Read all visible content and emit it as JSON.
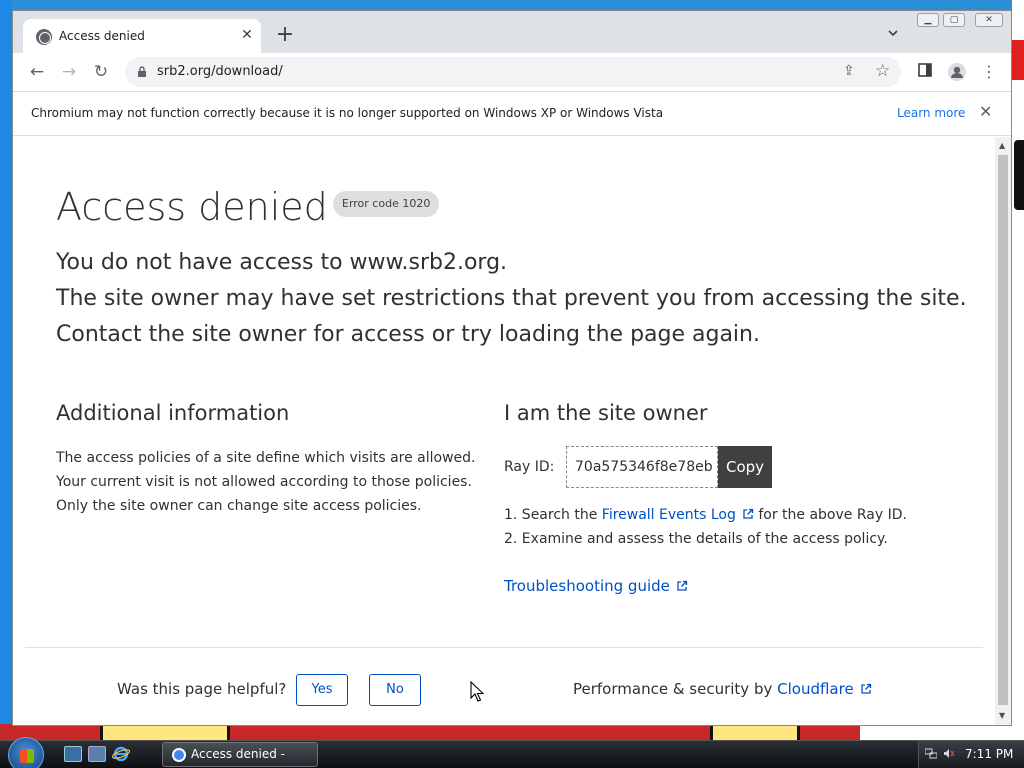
{
  "window": {
    "tab_title": "Access denied",
    "url": "srb2.org/download/"
  },
  "infobar": {
    "message": "Chromium may not function correctly because it is no longer supported on Windows XP or Windows Vista",
    "learn_more": "Learn more"
  },
  "page": {
    "heading": "Access denied",
    "error_code": "Error code 1020",
    "lead_lines": [
      "You do not have access to www.srb2.org.",
      "The site owner may have set restrictions that prevent you from accessing the site.",
      "Contact the site owner for access or try loading the page again."
    ],
    "additional": {
      "title": "Additional information",
      "lines": [
        "The access policies of a site define which visits are allowed.",
        "Your current visit is not allowed according to those policies.",
        "Only the site owner can change site access policies."
      ]
    },
    "owner": {
      "title": "I am the site owner",
      "ray_label": "Ray ID:",
      "ray_id": "70a575346f8e78eb",
      "copy_label": "Copy",
      "step1_prefix": "1. Search the ",
      "step1_link": "Firewall Events Log",
      "step1_suffix": " for the above Ray ID.",
      "step2": "2. Examine and assess the details of the access policy.",
      "troubleshooting": "Troubleshooting guide"
    },
    "footer": {
      "helpful_question": "Was this page helpful?",
      "yes": "Yes",
      "no": "No",
      "perf_prefix": "Performance & security by ",
      "perf_link": "Cloudflare"
    }
  },
  "taskbar": {
    "task_label": "Access denied - Chr...",
    "clock": "7:11 PM"
  },
  "colors": {
    "link": "#0051c3",
    "copy_button": "#404040",
    "learn_more": "#1a73e8"
  }
}
